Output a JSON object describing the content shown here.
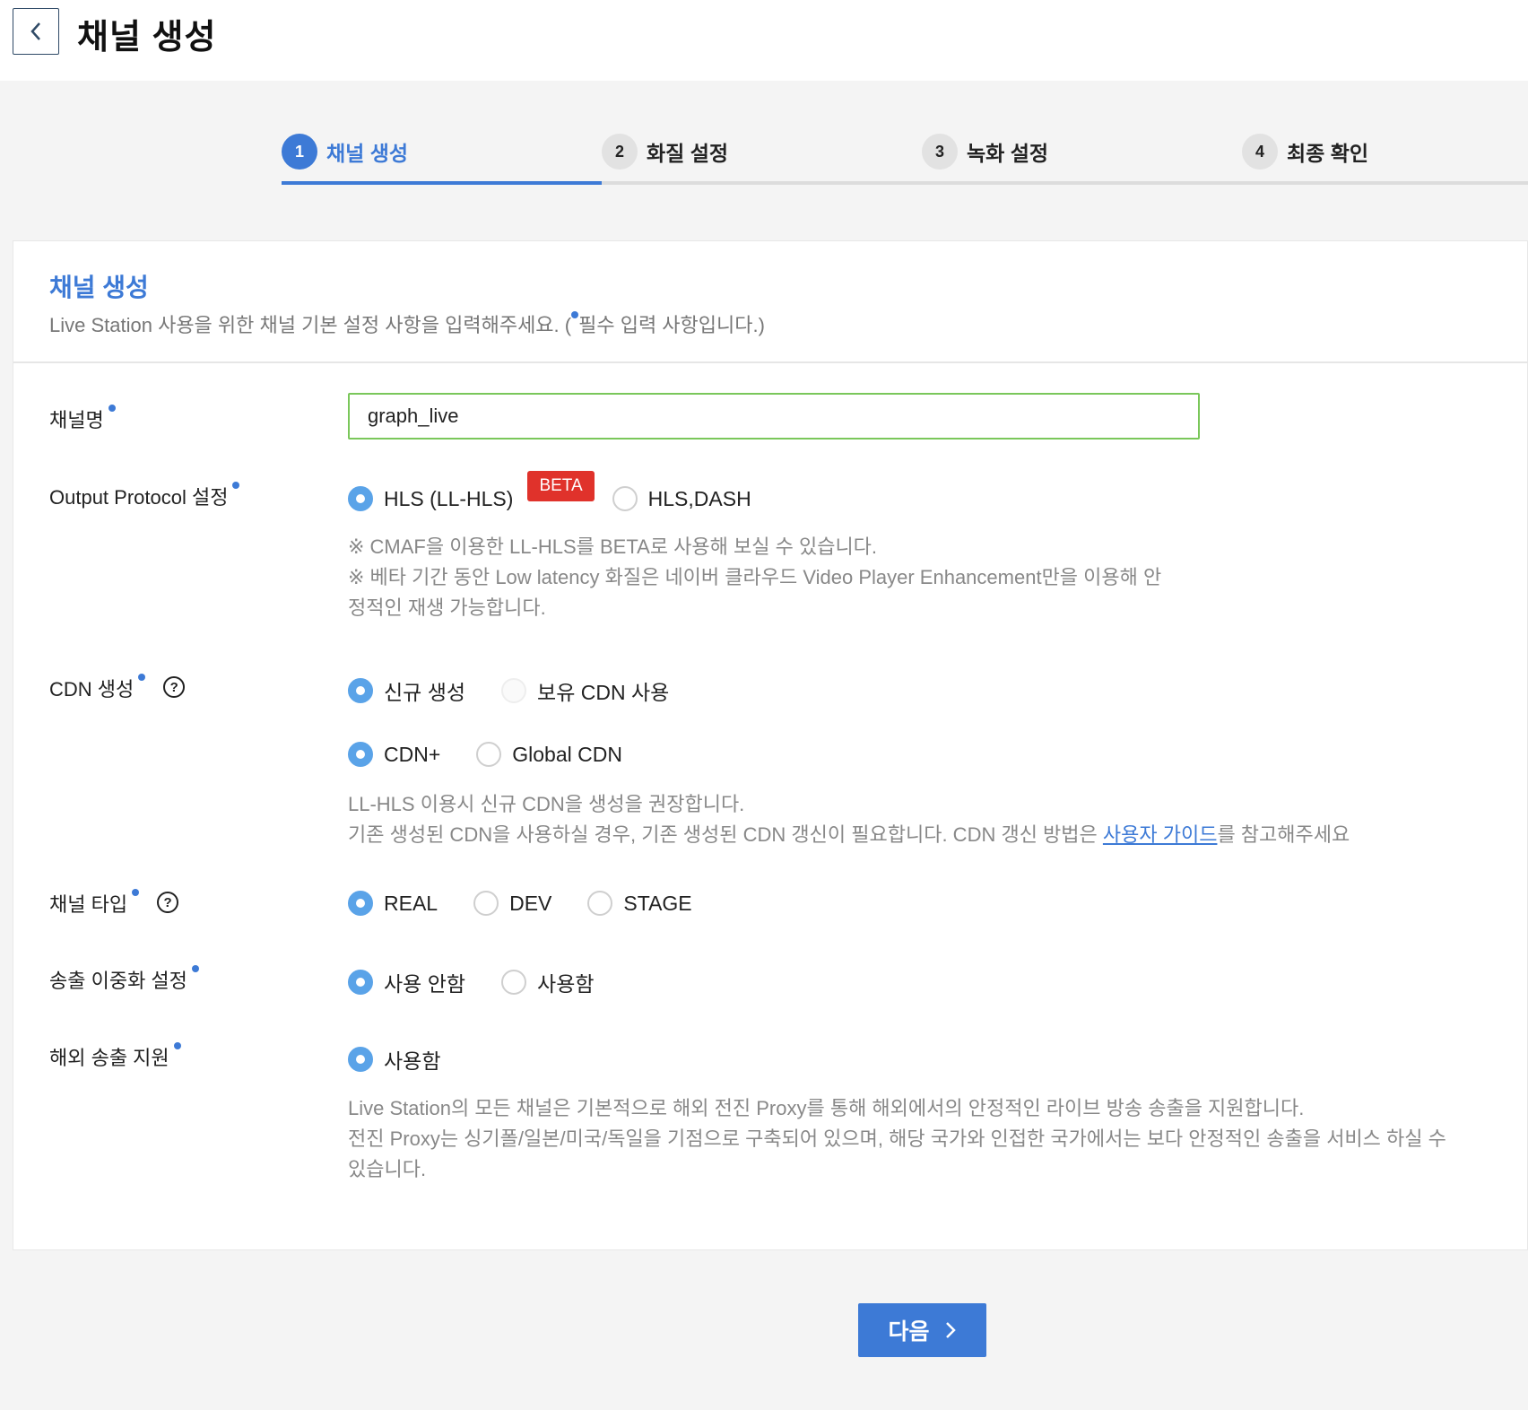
{
  "header": {
    "title": "채널 생성"
  },
  "steps": [
    {
      "num": "1",
      "label": "채널 생성",
      "active": true
    },
    {
      "num": "2",
      "label": "화질 설정",
      "active": false
    },
    {
      "num": "3",
      "label": "녹화 설정",
      "active": false
    },
    {
      "num": "4",
      "label": "최종 확인",
      "active": false
    }
  ],
  "card": {
    "title": "채널 생성",
    "desc_prefix": "Live Station 사용을 위한 채널 기본 설정 사항을 입력해주세요. (",
    "desc_suffix": "필수 입력 사항입니다.)"
  },
  "channel_name": {
    "label": "채널명",
    "value": "graph_live"
  },
  "output_protocol": {
    "label": "Output Protocol 설정",
    "options": [
      "HLS (LL-HLS)",
      "HLS,DASH"
    ],
    "selected": "HLS (LL-HLS)",
    "badge": "BETA",
    "notes": [
      "※ CMAF을 이용한 LL-HLS를 BETA로 사용해 보실 수 있습니다.",
      "※ 베타 기간 동안 Low latency 화질은 네이버 클라우드 Video Player Enhancement만을 이용해 안",
      "정적인 재생 가능합니다."
    ]
  },
  "cdn": {
    "label": "CDN 생성",
    "help": "?",
    "mode_options": [
      "신규 생성",
      "보유 CDN 사용"
    ],
    "mode_selected": "신규 생성",
    "type_options": [
      "CDN+",
      "Global CDN"
    ],
    "type_selected": "CDN+",
    "note_line1": "LL-HLS 이용시 신규 CDN을 생성을 권장합니다.",
    "note_line2_prefix": "기존 생성된 CDN을 사용하실 경우, 기존 생성된 CDN 갱신이 필요합니다. CDN 갱신 방법은 ",
    "note_link": "사용자 가이드",
    "note_line2_suffix": "를 참고해주세요"
  },
  "channel_type": {
    "label": "채널 타입",
    "help": "?",
    "options": [
      "REAL",
      "DEV",
      "STAGE"
    ],
    "selected": "REAL"
  },
  "redundancy": {
    "label": "송출 이중화 설정",
    "options": [
      "사용 안함",
      "사용함"
    ],
    "selected": "사용 안함"
  },
  "overseas": {
    "label": "해외 송출 지원",
    "options": [
      "사용함"
    ],
    "selected": "사용함",
    "notes": [
      "Live Station의 모든 채널은 기본적으로 해외 전진 Proxy를 통해 해외에서의 안정적인 라이브 방송 송출을 지원합니다.",
      "전진 Proxy는 싱기폴/일본/미국/독일을 기점으로 구축되어 있으며, 해당 국가와 인접한 국가에서는 보다 안정적인 송출을 서비스 하실 수",
      "있습니다."
    ]
  },
  "footer": {
    "next_label": "다음"
  },
  "colors": {
    "accent": "#3d7ad6",
    "radio": "#5aa3e8",
    "beta": "#e0322b",
    "input_border": "#7ac75a"
  }
}
